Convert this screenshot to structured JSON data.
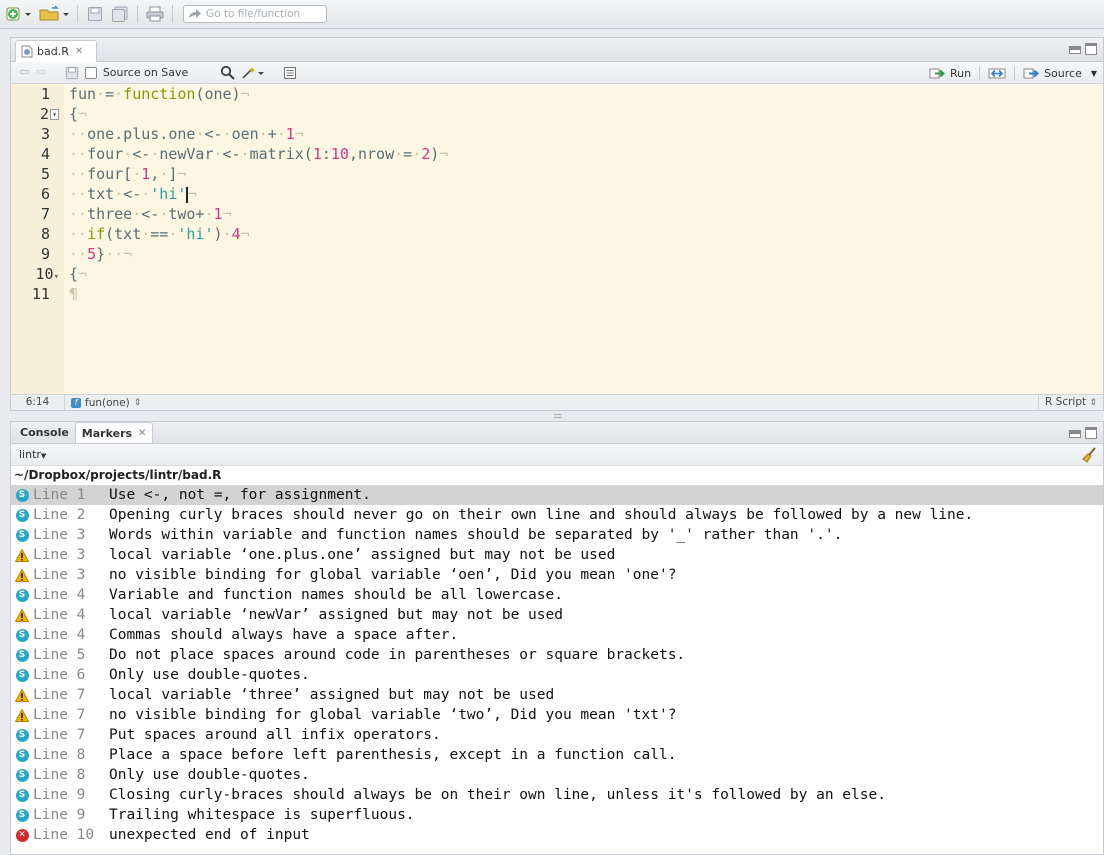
{
  "toolbar": {
    "goto_placeholder": "Go to file/function"
  },
  "editor": {
    "tab_label": "bad.R",
    "source_on_save": "Source on Save",
    "run_label": "Run",
    "source_label": "Source",
    "line_numbers": [
      "1",
      "2",
      "3",
      "4",
      "5",
      "6",
      "7",
      "8",
      "9",
      "10",
      "11"
    ],
    "status_position": "6:14",
    "status_scope": "fun(one)",
    "status_filetype": "R Script"
  },
  "bottom": {
    "tab_console": "Console",
    "tab_markers": "Markers",
    "filter_label": "lintr",
    "file_path": "~/Dropbox/projects/lintr/bad.R",
    "markers": [
      {
        "type": "style",
        "line": "Line 1",
        "message": "Use <-, not =, for assignment."
      },
      {
        "type": "style",
        "line": "Line 2",
        "message": "Opening curly braces should never go on their own line and should always be followed by a new line."
      },
      {
        "type": "style",
        "line": "Line 3",
        "message": "Words within variable and function names should be separated by '_' rather than '.'."
      },
      {
        "type": "warning",
        "line": "Line 3",
        "message": "local variable ‘one.plus.one’ assigned but may not be used"
      },
      {
        "type": "warning",
        "line": "Line 3",
        "message": "no visible binding for global variable ‘oen’, Did you mean 'one'?"
      },
      {
        "type": "style",
        "line": "Line 4",
        "message": "Variable and function names should be all lowercase."
      },
      {
        "type": "warning",
        "line": "Line 4",
        "message": "local variable ‘newVar’ assigned but may not be used"
      },
      {
        "type": "style",
        "line": "Line 4",
        "message": "Commas should always have a space after."
      },
      {
        "type": "style",
        "line": "Line 5",
        "message": "Do not place spaces around code in parentheses or square brackets."
      },
      {
        "type": "style",
        "line": "Line 6",
        "message": "Only use double-quotes."
      },
      {
        "type": "warning",
        "line": "Line 7",
        "message": "local variable ‘three’ assigned but may not be used"
      },
      {
        "type": "warning",
        "line": "Line 7",
        "message": "no visible binding for global variable ‘two’, Did you mean 'txt'?"
      },
      {
        "type": "style",
        "line": "Line 7",
        "message": "Put spaces around all infix operators."
      },
      {
        "type": "style",
        "line": "Line 8",
        "message": "Place a space before left parenthesis, except in a function call."
      },
      {
        "type": "style",
        "line": "Line 8",
        "message": "Only use double-quotes."
      },
      {
        "type": "style",
        "line": "Line 9",
        "message": "Closing curly-braces should always be on their own line, unless it's followed by an else."
      },
      {
        "type": "style",
        "line": "Line 9",
        "message": "Trailing whitespace is superfluous."
      },
      {
        "type": "error",
        "line": "Line 10",
        "message": "unexpected end of input"
      }
    ]
  },
  "colors": {
    "editor_bg": "#fdf6e3",
    "keyword": "#859900",
    "number": "#d33682",
    "string": "#2aa198",
    "style_icon": "#28a8c9",
    "error_icon": "#d12a2a",
    "warning_icon": "#f0b400",
    "selected_row": "#d3d3d3"
  }
}
